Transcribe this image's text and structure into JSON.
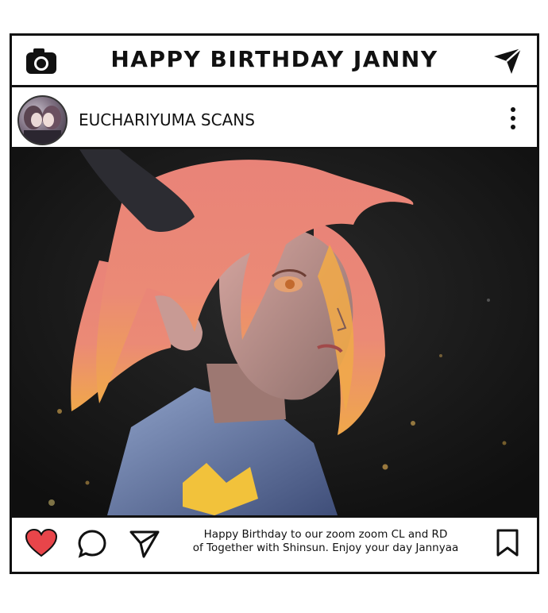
{
  "post": {
    "title": "HAPPY BIRTHDAY JANNY",
    "username": "EUCHARIYUMA SCANS",
    "caption_line1": "Happy Birthday to our zoom zoom CL and RD",
    "caption_line2": "of Together with Shinsun. Enjoy your day Jannyaa"
  },
  "icons": {
    "top_left": "camera-icon",
    "top_right": "send-icon",
    "profile_menu": "more-vertical-icon",
    "like": "heart-icon",
    "comment": "comment-icon",
    "share": "send-icon",
    "save": "bookmark-icon"
  },
  "colors": {
    "frame": "#111111",
    "like": "#e8454a",
    "background": "#ffffff"
  }
}
